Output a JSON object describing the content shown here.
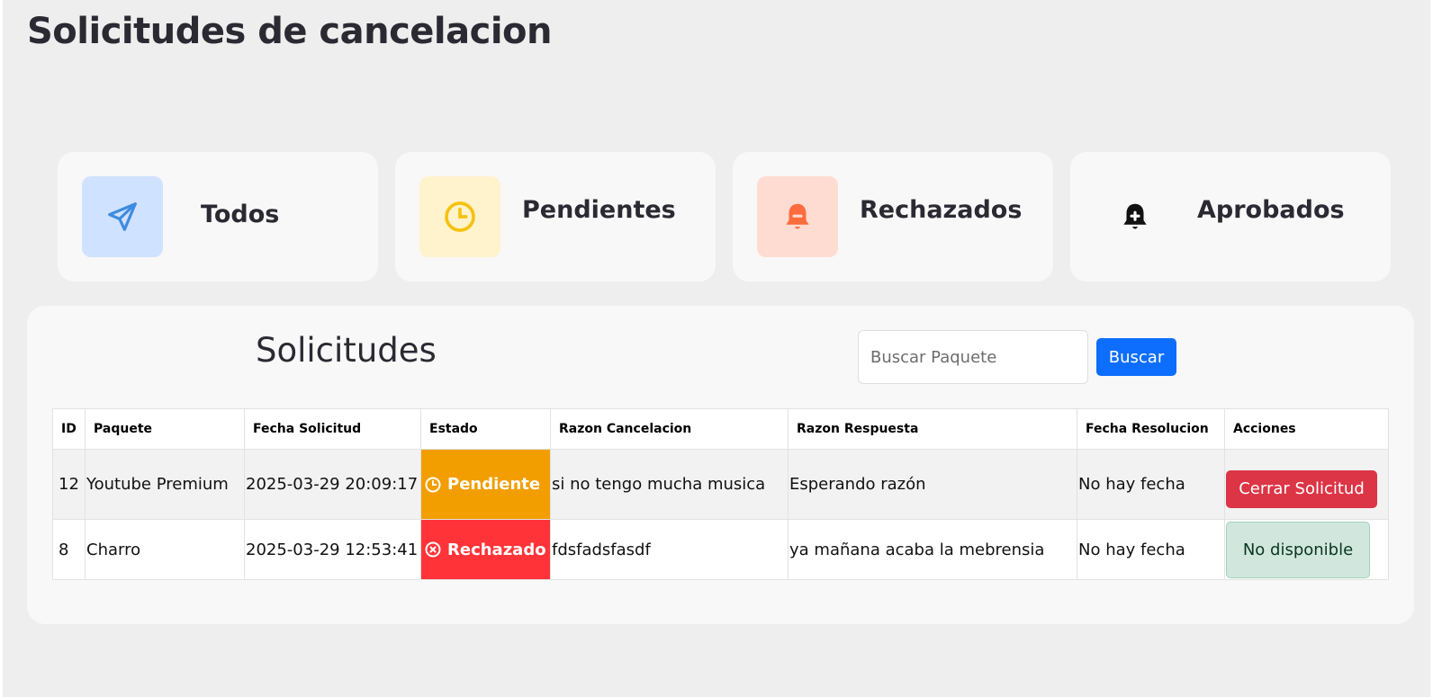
{
  "page": {
    "title": "Solicitudes de cancelacion"
  },
  "cards": [
    {
      "label": "Todos",
      "icon": "paper-plane-icon",
      "icon_color": "#3d8be0",
      "bg_color": "#cfe2ff"
    },
    {
      "label": "Pendientes",
      "icon": "clock-icon",
      "icon_color": "#f5c211",
      "bg_color": "#fff3cd"
    },
    {
      "label": "Rechazados",
      "icon": "bell-minus-icon",
      "icon_color": "#fd6c3d",
      "bg_color": "#ffdcd1"
    },
    {
      "label": "Aprobados",
      "icon": "bell-plus-icon",
      "icon_color": "#111111",
      "bg_color": "#f8f8f8"
    }
  ],
  "panel": {
    "title": "Solicitudes",
    "search_placeholder": "Buscar Paquete",
    "search_value": "",
    "search_button": "Buscar"
  },
  "table": {
    "headers": [
      "ID",
      "Paquete",
      "Fecha Solicitud",
      "Estado",
      "Razon Cancelacion",
      "Razon Respuesta",
      "Fecha Resolucion",
      "Acciones"
    ],
    "rows": [
      {
        "id": "12",
        "paquete": "Youtube Premium",
        "fecha_solicitud": "2025-03-29 20:09:17",
        "estado": "Pendiente",
        "estado_icon": "clock-icon",
        "estado_color": "#f29e00",
        "razon_cancelacion": "si no tengo mucha musica",
        "razon_respuesta": "Esperando razón",
        "fecha_resolucion": "No hay fecha",
        "accion": "Cerrar Solicitud"
      },
      {
        "id": "8",
        "paquete": "Charro",
        "fecha_solicitud": "2025-03-29 12:53:41",
        "estado": "Rechazado",
        "estado_icon": "x-circle-icon",
        "estado_color": "#ff3338",
        "razon_cancelacion": "fdsfadsfasdf",
        "razon_respuesta": "ya mañana acaba la mebrensia",
        "fecha_resolucion": "No hay fecha",
        "accion": "No disponible"
      }
    ]
  }
}
